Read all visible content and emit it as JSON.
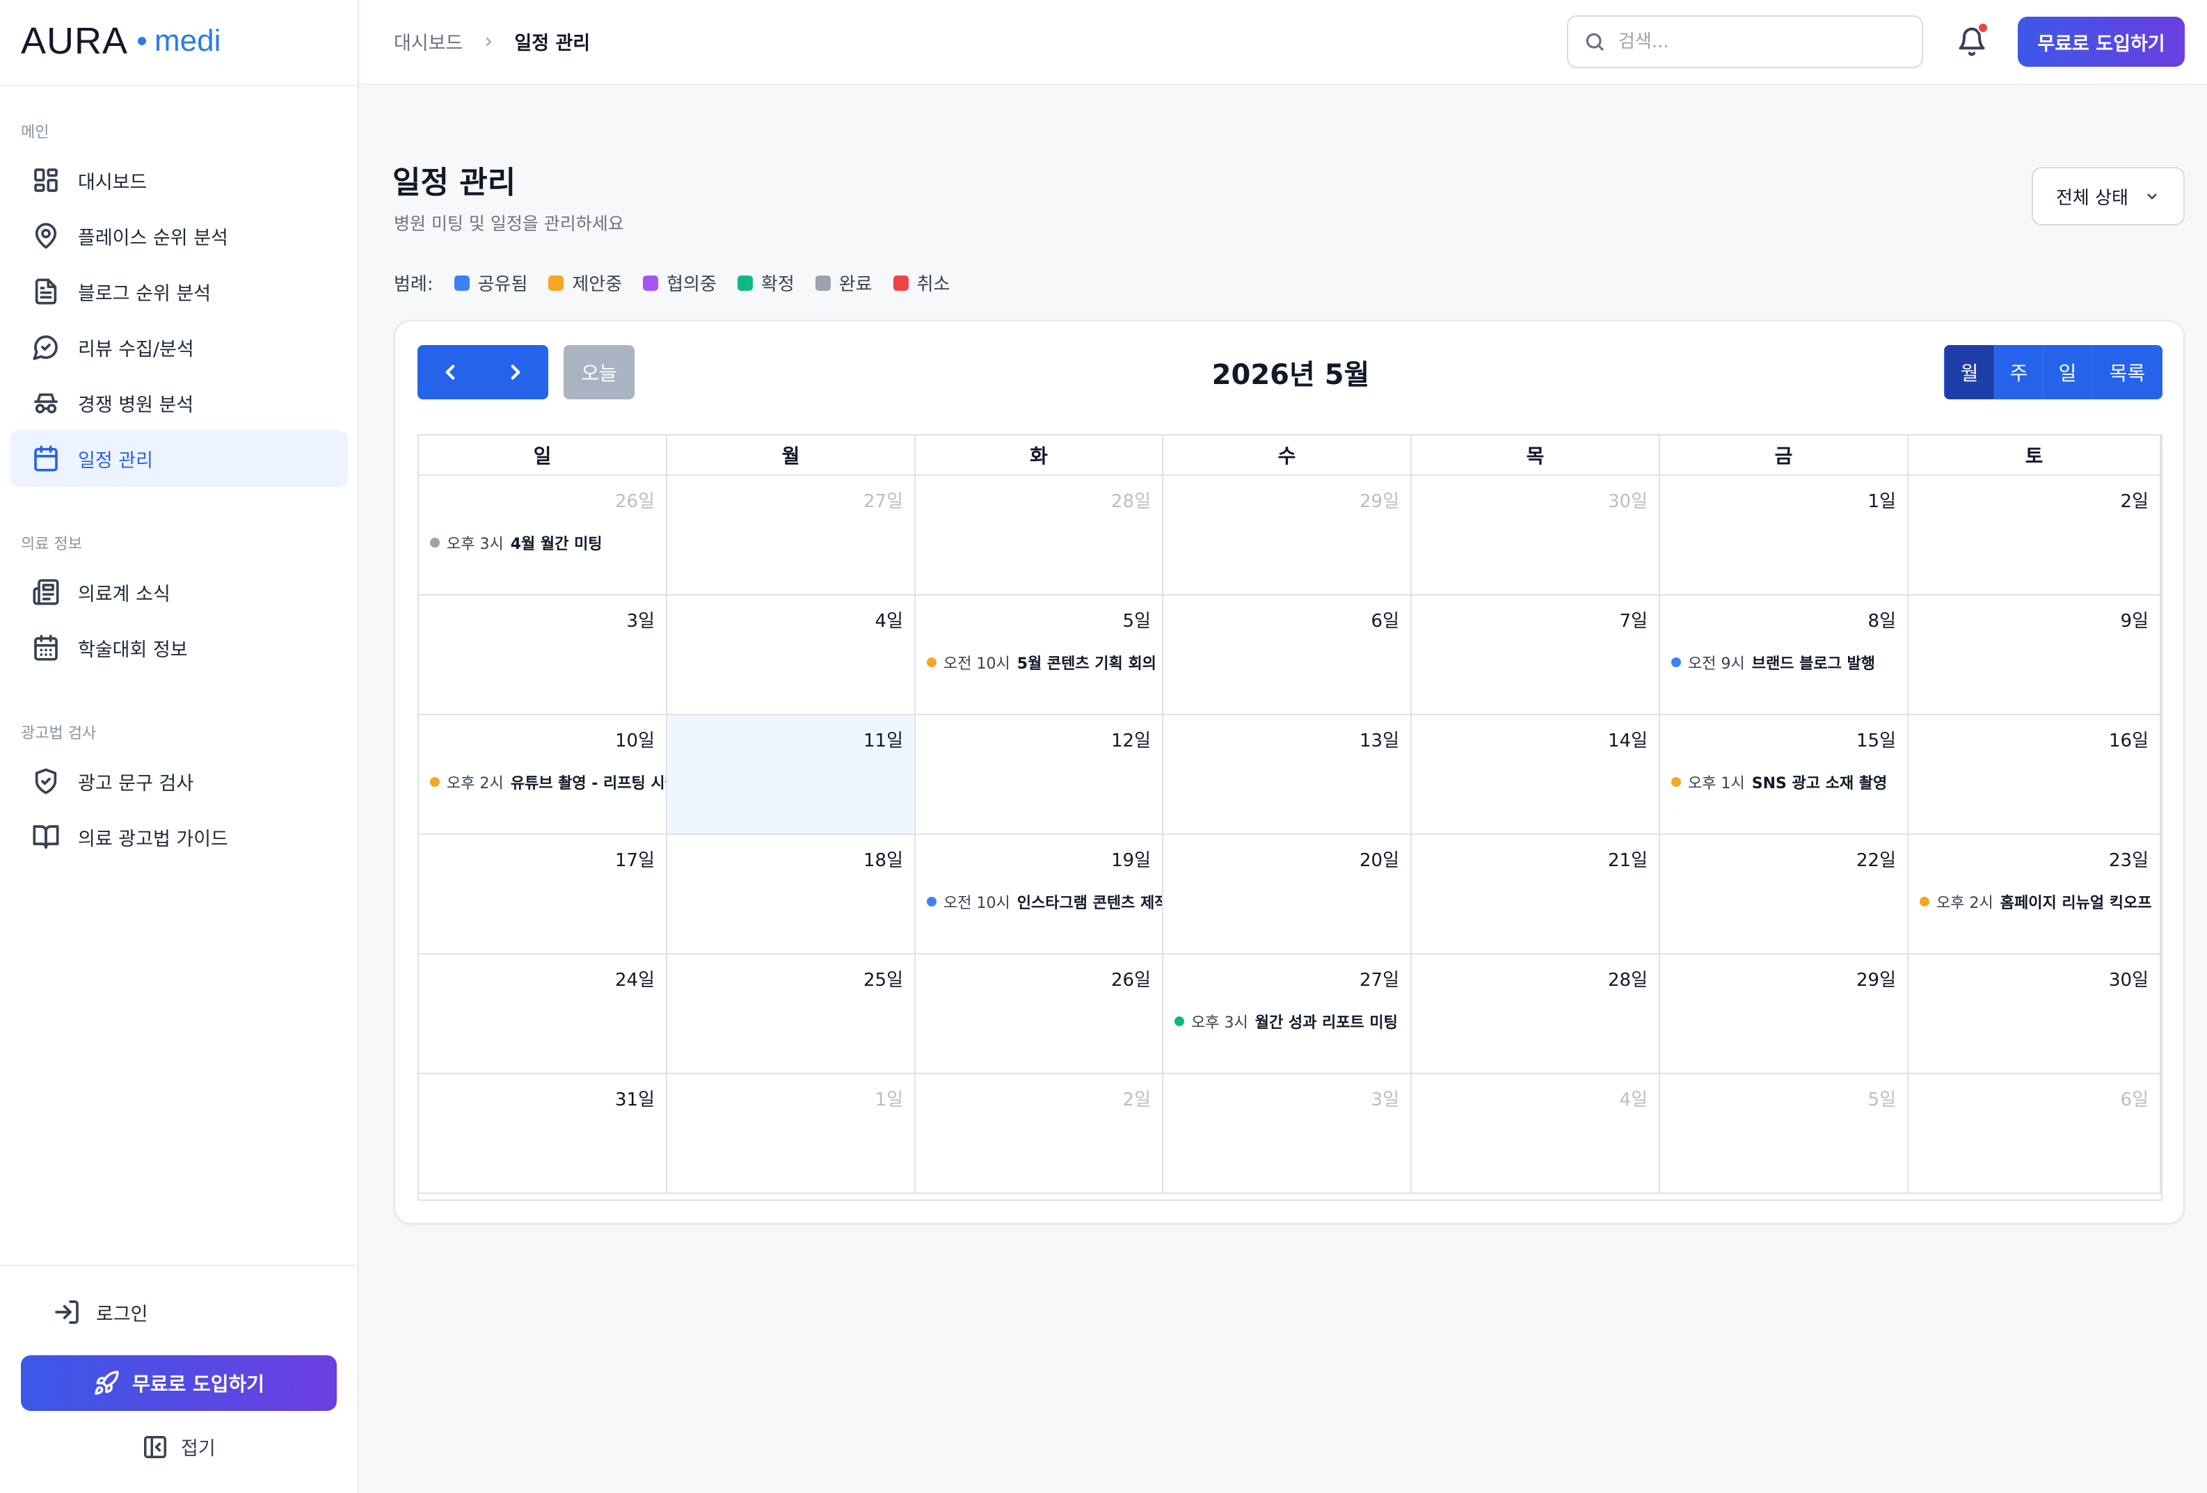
{
  "brand": {
    "name_left": "AURA",
    "name_right": "medi"
  },
  "sidebar": {
    "sections": [
      {
        "title": "메인",
        "items": [
          {
            "label": "대시보드",
            "icon": "dashboard-icon"
          },
          {
            "label": "플레이스 순위 분석",
            "icon": "map-pin-icon"
          },
          {
            "label": "블로그 순위 분석",
            "icon": "document-icon"
          },
          {
            "label": "리뷰 수집/분석",
            "icon": "chat-check-icon"
          },
          {
            "label": "경쟁 병원 분석",
            "icon": "spy-icon"
          },
          {
            "label": "일정 관리",
            "icon": "calendar-icon",
            "active": true
          }
        ]
      },
      {
        "title": "의료 정보",
        "items": [
          {
            "label": "의료계 소식",
            "icon": "newspaper-icon"
          },
          {
            "label": "학술대회 정보",
            "icon": "calendar-days-icon"
          }
        ]
      },
      {
        "title": "광고법 검사",
        "items": [
          {
            "label": "광고 문구 검사",
            "icon": "shield-check-icon"
          },
          {
            "label": "의료 광고법 가이드",
            "icon": "book-open-icon"
          }
        ]
      }
    ],
    "login_label": "로그인",
    "cta_label": "무료로 도입하기",
    "collapse_label": "접기"
  },
  "header": {
    "breadcrumb": [
      "대시보드",
      "일정 관리"
    ],
    "search_placeholder": "검색...",
    "cta_label": "무료로 도입하기",
    "notification_badge": true
  },
  "page": {
    "title": "일정 관리",
    "subtitle": "병원 미팅 및 일정을 관리하세요",
    "status_filter": "전체 상태"
  },
  "legend": {
    "label": "범례:",
    "items": [
      {
        "label": "공유됨",
        "color": "#3b82f6"
      },
      {
        "label": "제안중",
        "color": "#f5a623"
      },
      {
        "label": "협의중",
        "color": "#a855f7"
      },
      {
        "label": "확정",
        "color": "#10b981"
      },
      {
        "label": "완료",
        "color": "#9ca3af"
      },
      {
        "label": "취소",
        "color": "#ef4444"
      }
    ]
  },
  "calendar": {
    "title": "2026년 5월",
    "today_label": "오늘",
    "views": [
      {
        "label": "월",
        "active": true
      },
      {
        "label": "주"
      },
      {
        "label": "일"
      },
      {
        "label": "목록"
      }
    ],
    "weekdays": [
      "일",
      "월",
      "화",
      "수",
      "목",
      "금",
      "토"
    ],
    "weeks": [
      [
        {
          "day": "26일",
          "other": true,
          "event": {
            "time": "오후 3시",
            "title": "4월 월간 미팅",
            "color": "#9ca3af"
          }
        },
        {
          "day": "27일",
          "other": true
        },
        {
          "day": "28일",
          "other": true
        },
        {
          "day": "29일",
          "other": true
        },
        {
          "day": "30일",
          "other": true
        },
        {
          "day": "1일"
        },
        {
          "day": "2일"
        }
      ],
      [
        {
          "day": "3일"
        },
        {
          "day": "4일"
        },
        {
          "day": "5일",
          "event": {
            "time": "오전 10시",
            "title": "5월 콘텐츠 기획 회의",
            "color": "#f5a623"
          }
        },
        {
          "day": "6일"
        },
        {
          "day": "7일"
        },
        {
          "day": "8일",
          "event": {
            "time": "오전 9시",
            "title": "브랜드 블로그 발행",
            "color": "#3b82f6"
          }
        },
        {
          "day": "9일"
        }
      ],
      [
        {
          "day": "10일",
          "event": {
            "time": "오후 2시",
            "title": "유튜브 촬영 - 리프팅 시술",
            "color": "#f5a623"
          }
        },
        {
          "day": "11일",
          "today": true
        },
        {
          "day": "12일"
        },
        {
          "day": "13일"
        },
        {
          "day": "14일"
        },
        {
          "day": "15일",
          "event": {
            "time": "오후 1시",
            "title": "SNS 광고 소재 촬영",
            "color": "#f5a623"
          }
        },
        {
          "day": "16일"
        }
      ],
      [
        {
          "day": "17일"
        },
        {
          "day": "18일"
        },
        {
          "day": "19일",
          "event": {
            "time": "오전 10시",
            "title": "인스타그램 콘텐츠 제작",
            "color": "#3b82f6"
          }
        },
        {
          "day": "20일"
        },
        {
          "day": "21일"
        },
        {
          "day": "22일"
        },
        {
          "day": "23일",
          "event": {
            "time": "오후 2시",
            "title": "홈페이지 리뉴얼 킥오프",
            "color": "#f5a623"
          }
        }
      ],
      [
        {
          "day": "24일"
        },
        {
          "day": "25일"
        },
        {
          "day": "26일"
        },
        {
          "day": "27일",
          "event": {
            "time": "오후 3시",
            "title": "월간 성과 리포트 미팅",
            "color": "#10b981"
          }
        },
        {
          "day": "28일"
        },
        {
          "day": "29일"
        },
        {
          "day": "30일"
        }
      ],
      [
        {
          "day": "31일"
        },
        {
          "day": "1일",
          "other": true
        },
        {
          "day": "2일",
          "other": true
        },
        {
          "day": "3일",
          "other": true
        },
        {
          "day": "4일",
          "other": true
        },
        {
          "day": "5일",
          "other": true
        },
        {
          "day": "6일",
          "other": true
        }
      ]
    ]
  }
}
